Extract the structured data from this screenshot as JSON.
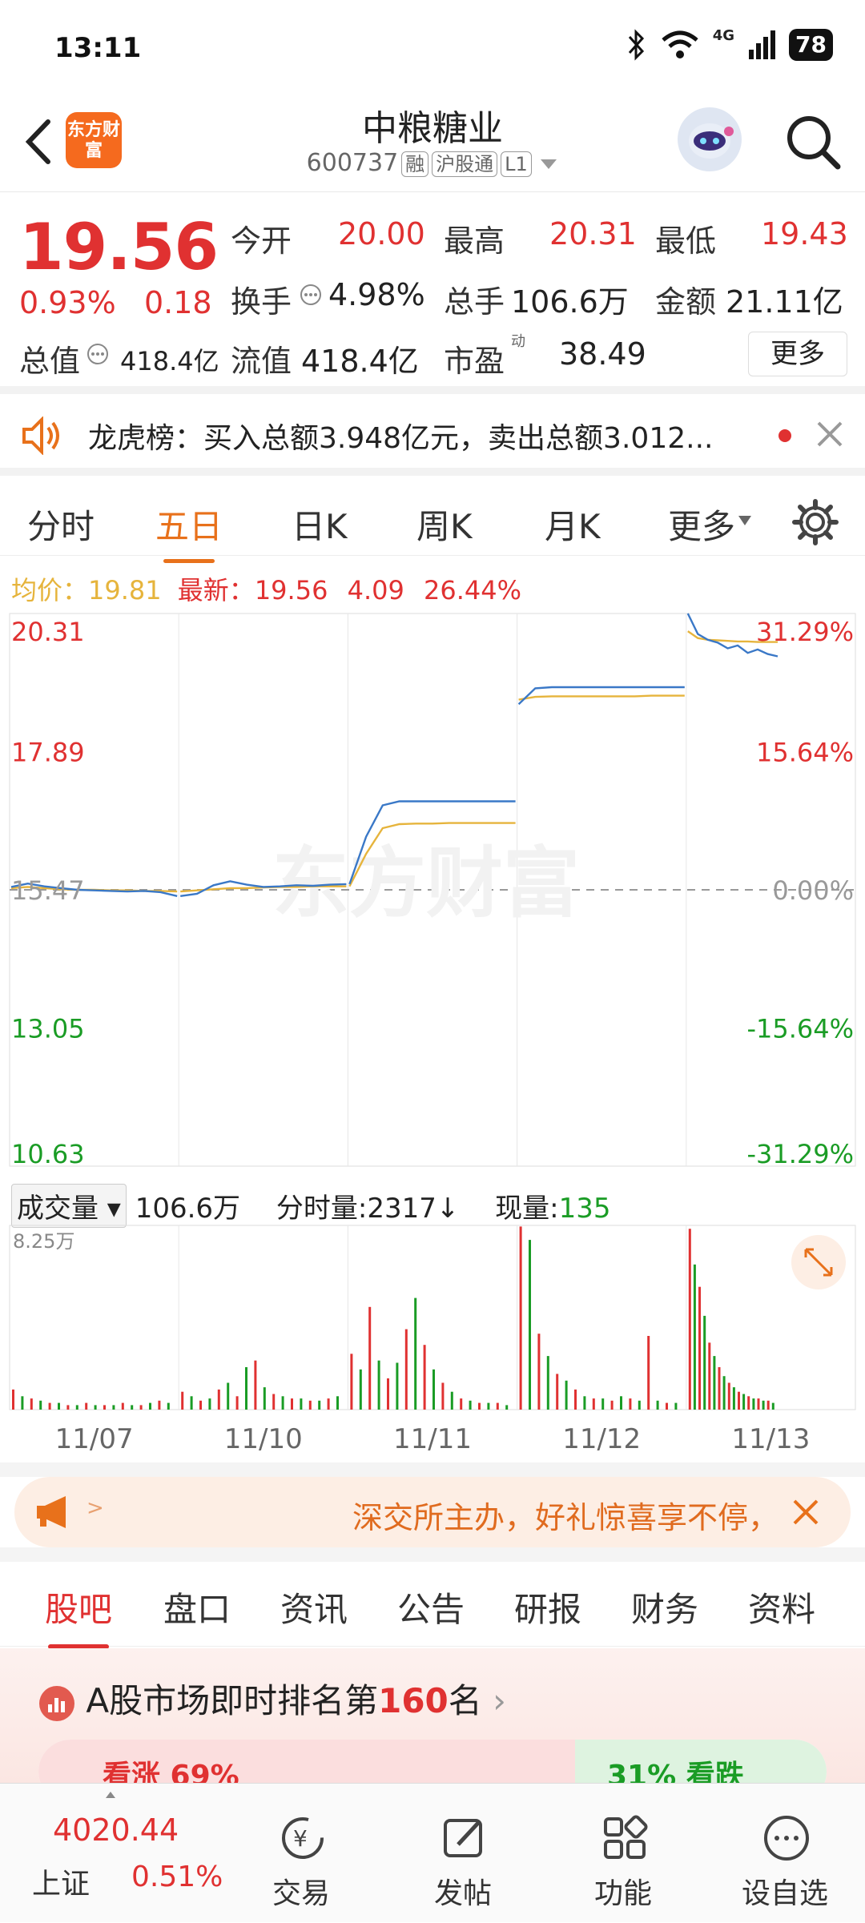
{
  "status_bar": {
    "time": "13:11",
    "network": "4G",
    "battery": "78"
  },
  "header": {
    "logo_text": "东方财富",
    "stock_name": "中粮糖业",
    "stock_code": "600737",
    "tags": [
      "融",
      "沪股通",
      "L1"
    ]
  },
  "quote": {
    "price": "19.56",
    "change_pct": "0.93%",
    "change": "0.18",
    "open_label": "今开",
    "open": "20.00",
    "high_label": "最高",
    "high": "20.31",
    "low_label": "最低",
    "low": "19.43",
    "turnover_label": "换手",
    "turnover": "4.98%",
    "volume_label": "总手",
    "volume": "106.6万",
    "amount_label": "金额",
    "amount": "21.11亿",
    "total_value_label": "总值",
    "total_value": "418.4亿",
    "float_value_label": "流值",
    "float_value": "418.4亿",
    "pe_label": "市盈",
    "pe_superscript": "动",
    "pe": "38.49",
    "more_button": "更多"
  },
  "notice": {
    "text": "龙虎榜：买入总额3.948亿元，卖出总额3.012..."
  },
  "tabs": [
    {
      "label": "分时",
      "active": false
    },
    {
      "label": "五日",
      "active": true
    },
    {
      "label": "日K",
      "active": false
    },
    {
      "label": "周K",
      "active": false
    },
    {
      "label": "月K",
      "active": false
    },
    {
      "label": "更多",
      "active": false
    }
  ],
  "price_info": {
    "avg_label": "均价：",
    "avg": "19.81",
    "latest_label": "最新：",
    "latest": "19.56",
    "change": "4.09",
    "change_pct": "26.44%"
  },
  "watermark": "东方财富",
  "chart_data": {
    "type": "line",
    "title": "",
    "x_days": [
      "11/07",
      "11/10",
      "11/11",
      "11/12",
      "11/13"
    ],
    "y_ticks_left": [
      "20.31",
      "17.89",
      "15.47",
      "13.05",
      "10.63"
    ],
    "y_ticks_right": [
      "31.29%",
      "15.64%",
      "0.00%",
      "-15.64%",
      "-31.29%"
    ],
    "ylim": [
      10.63,
      20.31
    ],
    "prev_close": 15.47,
    "series": [
      {
        "name": "",
        "color": "#3a78c7",
        "days": [
          [
            15.52,
            15.58,
            15.53,
            15.5,
            15.47,
            15.46,
            15.45,
            15.44,
            15.45,
            15.43,
            15.36
          ],
          [
            15.36,
            15.4,
            15.55,
            15.62,
            15.56,
            15.52,
            15.53,
            15.55,
            15.54,
            15.56,
            15.57
          ],
          [
            15.57,
            16.4,
            16.95,
            17.02,
            17.02,
            17.02,
            17.02,
            17.02,
            17.02,
            17.02,
            17.02
          ],
          [
            18.72,
            19.0,
            19.02,
            19.02,
            19.02,
            19.02,
            19.02,
            19.02,
            19.02,
            19.02,
            19.02
          ],
          [
            20.31,
            19.95,
            19.85,
            19.8,
            19.7,
            19.75,
            19.62,
            19.68,
            19.6,
            19.56
          ]
        ]
      },
      {
        "name": "",
        "color": "#e6b43c",
        "days": [
          [
            15.5,
            15.52,
            15.5,
            15.48,
            15.47,
            15.47,
            15.46,
            15.46,
            15.45,
            15.45,
            15.44
          ],
          [
            15.44,
            15.46,
            15.48,
            15.5,
            15.5,
            15.51,
            15.52,
            15.52,
            15.53,
            15.53,
            15.53
          ],
          [
            15.53,
            16.1,
            16.55,
            16.62,
            16.63,
            16.63,
            16.64,
            16.64,
            16.64,
            16.64,
            16.64
          ],
          [
            18.8,
            18.85,
            18.86,
            18.86,
            18.86,
            18.86,
            18.86,
            18.86,
            18.87,
            18.87,
            18.87
          ],
          [
            20.0,
            19.88,
            19.85,
            19.84,
            19.83,
            19.82,
            19.82,
            19.81,
            19.81,
            19.81
          ]
        ]
      }
    ],
    "volume": {
      "label": "成交量",
      "total": "106.6万",
      "tick_label": "分时量:",
      "tick_value": "2317",
      "current_label": "现量:",
      "current_value": "135",
      "max_label": "8.25万",
      "max": 8.25,
      "days": [
        [
          0.9,
          0.6,
          0.5,
          0.4,
          0.3,
          0.3,
          0.2,
          0.2,
          0.3,
          0.2,
          0.2,
          0.2,
          0.3,
          0.2,
          0.2,
          0.3,
          0.4,
          0.3
        ],
        [
          0.8,
          0.6,
          0.4,
          0.5,
          0.9,
          1.2,
          0.6,
          1.9,
          2.2,
          1.0,
          0.7,
          0.6,
          0.5,
          0.5,
          0.4,
          0.4,
          0.5,
          0.6
        ],
        [
          2.5,
          1.8,
          4.6,
          2.2,
          1.4,
          2.1,
          3.6,
          5.0,
          2.9,
          1.8,
          1.2,
          0.8,
          0.5,
          0.4,
          0.3,
          0.3,
          0.3,
          0.2
        ],
        [
          8.2,
          7.6,
          3.4,
          2.4,
          1.6,
          1.3,
          0.9,
          0.6,
          0.5,
          0.5,
          0.4,
          0.6,
          0.5,
          0.4,
          3.3,
          0.4,
          0.3,
          0.3
        ],
        [
          8.1,
          6.5,
          5.5,
          4.2,
          3.0,
          2.4,
          1.9,
          1.5,
          1.2,
          1.0,
          0.8,
          0.7,
          0.6,
          0.5,
          0.5,
          0.4,
          0.4,
          0.3
        ]
      ]
    }
  },
  "banner": {
    "text": "深交所主办，好礼惊喜享不停，"
  },
  "subtabs": [
    {
      "label": "股吧",
      "active": true
    },
    {
      "label": "盘口",
      "active": false
    },
    {
      "label": "资讯",
      "active": false
    },
    {
      "label": "公告",
      "active": false
    },
    {
      "label": "研报",
      "active": false
    },
    {
      "label": "财务",
      "active": false
    },
    {
      "label": "资料",
      "active": false
    }
  ],
  "rank": {
    "prefix": "A股市场即时排名第",
    "number": "160",
    "suffix": "名",
    "up_text": "看涨 69%",
    "down_text": "31% 看跌"
  },
  "bottom_nav": {
    "index_value": "4020.44",
    "index_name": "上证",
    "index_change": "0.51%",
    "items": [
      "交易",
      "发帖",
      "功能",
      "设自选"
    ]
  }
}
